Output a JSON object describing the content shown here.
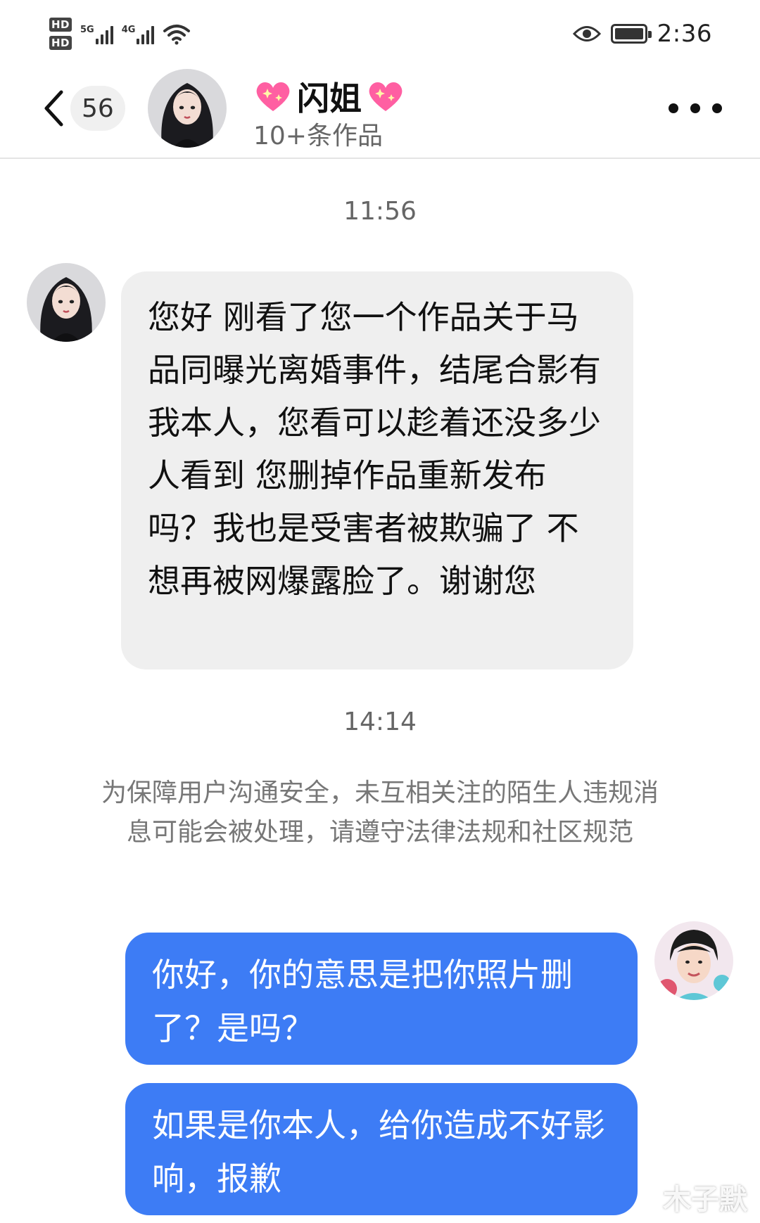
{
  "status_bar": {
    "hd1": "HD",
    "hd2": "HD",
    "net1": "5G",
    "net2": "4G",
    "time": "2:36"
  },
  "header": {
    "unread_count": "56",
    "contact_name": "闪姐",
    "subtitle": "10+条作品",
    "accent_heart_color": "#ff5fa2"
  },
  "chat": {
    "timestamp_1": "11:56",
    "incoming_message": "您好 刚看了您一个作品关于马品同曝光离婚事件，结尾合影有我本人，您看可以趁着还没多少人看到 您删掉作品重新发布吗？我也是受害者被欺骗了 不想再被网爆露脸了。谢谢您",
    "timestamp_2": "14:14",
    "system_notice": "为保障用户沟通安全，未互相关注的陌生人违规消息可能会被处理，请遵守法律法规和社区规范",
    "outgoing_messages": [
      "你好，你的意思是把你照片删了？是吗？",
      "如果是你本人，给你造成不好影响，报歉"
    ],
    "outgoing_bubble_color": "#3d7cf5",
    "incoming_bubble_color": "#efefef"
  },
  "watermark": "木子默"
}
